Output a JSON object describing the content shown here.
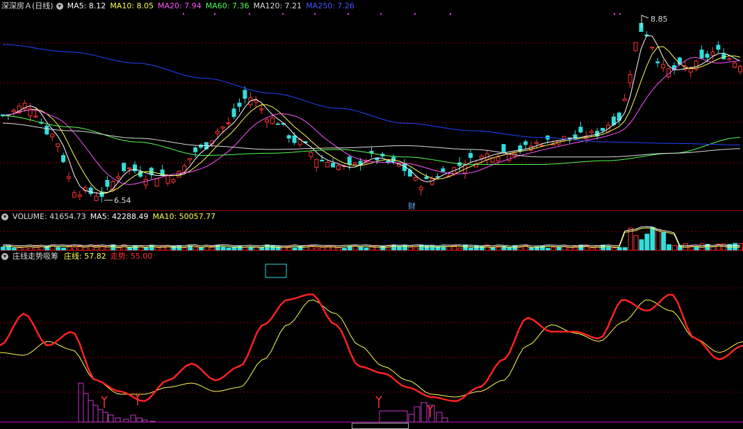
{
  "price_panel": {
    "stock_name": "深深房Ａ(日线)",
    "ma_labels": [
      {
        "text": "MA5: 8.12",
        "color": "#ffffff"
      },
      {
        "text": "MA10: 8.05",
        "color": "#ffff55"
      },
      {
        "text": "MA20: 7.94",
        "color": "#ff55ff"
      },
      {
        "text": "MA60: 7.36",
        "color": "#55ff55"
      },
      {
        "text": "MA120: 7.21",
        "color": "#dddddd"
      },
      {
        "text": "MA250: 7.26",
        "color": "#4455ff"
      }
    ],
    "high_label": "8.85",
    "low_label": "6.54",
    "finance_marker": "财"
  },
  "volume_panel": {
    "labels": [
      {
        "text": "VOLUME: 41654.73",
        "color": "#dddddd"
      },
      {
        "text": "MA5: 42288.49",
        "color": "#ffffff"
      },
      {
        "text": "MA10: 50057.77",
        "color": "#ffff55"
      }
    ]
  },
  "indicator_panel": {
    "title": "庄线走势吸筹",
    "labels": [
      {
        "text": "庄线: 57.82",
        "color": "#ffff55"
      },
      {
        "text": "走势: 55.00",
        "color": "#ff3333"
      }
    ]
  },
  "colors": {
    "up": "#ff3333",
    "down": "#33dddd",
    "grid": "#8a0000",
    "ma250": "#2244ff"
  },
  "chart_data": [
    {
      "type": "candlestick",
      "title": "深深房Ａ(日线)",
      "yrange": [
        6.3,
        9.1
      ],
      "annotations": [
        {
          "label": "8.85",
          "type": "high"
        },
        {
          "label": "6.54",
          "type": "low"
        }
      ],
      "series": [
        {
          "name": "MA250",
          "values": [
            8.6,
            8.5,
            8.35,
            8.15,
            7.95,
            7.75,
            7.55,
            7.45,
            7.36,
            7.3,
            7.28,
            7.26
          ]
        },
        {
          "name": "MA120",
          "values": [
            7.55,
            7.45,
            7.35,
            7.25,
            7.2,
            7.22,
            7.25,
            7.2,
            7.1,
            7.1,
            7.15,
            7.21
          ]
        },
        {
          "name": "MA60",
          "values": [
            7.65,
            7.5,
            7.3,
            7.12,
            7.15,
            7.2,
            7.1,
            7.0,
            7.0,
            7.05,
            7.15,
            7.36
          ]
        },
        {
          "name": "MA20",
          "values": [
            7.65,
            7.2,
            6.85,
            7.0,
            7.25,
            7.2,
            6.9,
            6.95,
            7.05,
            7.1,
            7.5,
            7.94
          ]
        }
      ]
    },
    {
      "type": "bar",
      "title": "VOLUME",
      "series": [
        {
          "name": "VOLUME",
          "values": [
            41654.73
          ]
        },
        {
          "name": "MA5",
          "values": [
            42288.49
          ]
        },
        {
          "name": "MA10",
          "values": [
            50057.77
          ]
        }
      ]
    },
    {
      "type": "line",
      "title": "庄线走势吸筹",
      "yrange": [
        0,
        100
      ],
      "series": [
        {
          "name": "庄线",
          "values": [
            50,
            52,
            30,
            22,
            30,
            60,
            88,
            70,
            40,
            22,
            28,
            55,
            62,
            80,
            55,
            57.82
          ]
        },
        {
          "name": "走势",
          "values": [
            52,
            70,
            20,
            25,
            40,
            70,
            92,
            50,
            20,
            15,
            40,
            88,
            72,
            90,
            40,
            55.0
          ]
        }
      ]
    }
  ]
}
